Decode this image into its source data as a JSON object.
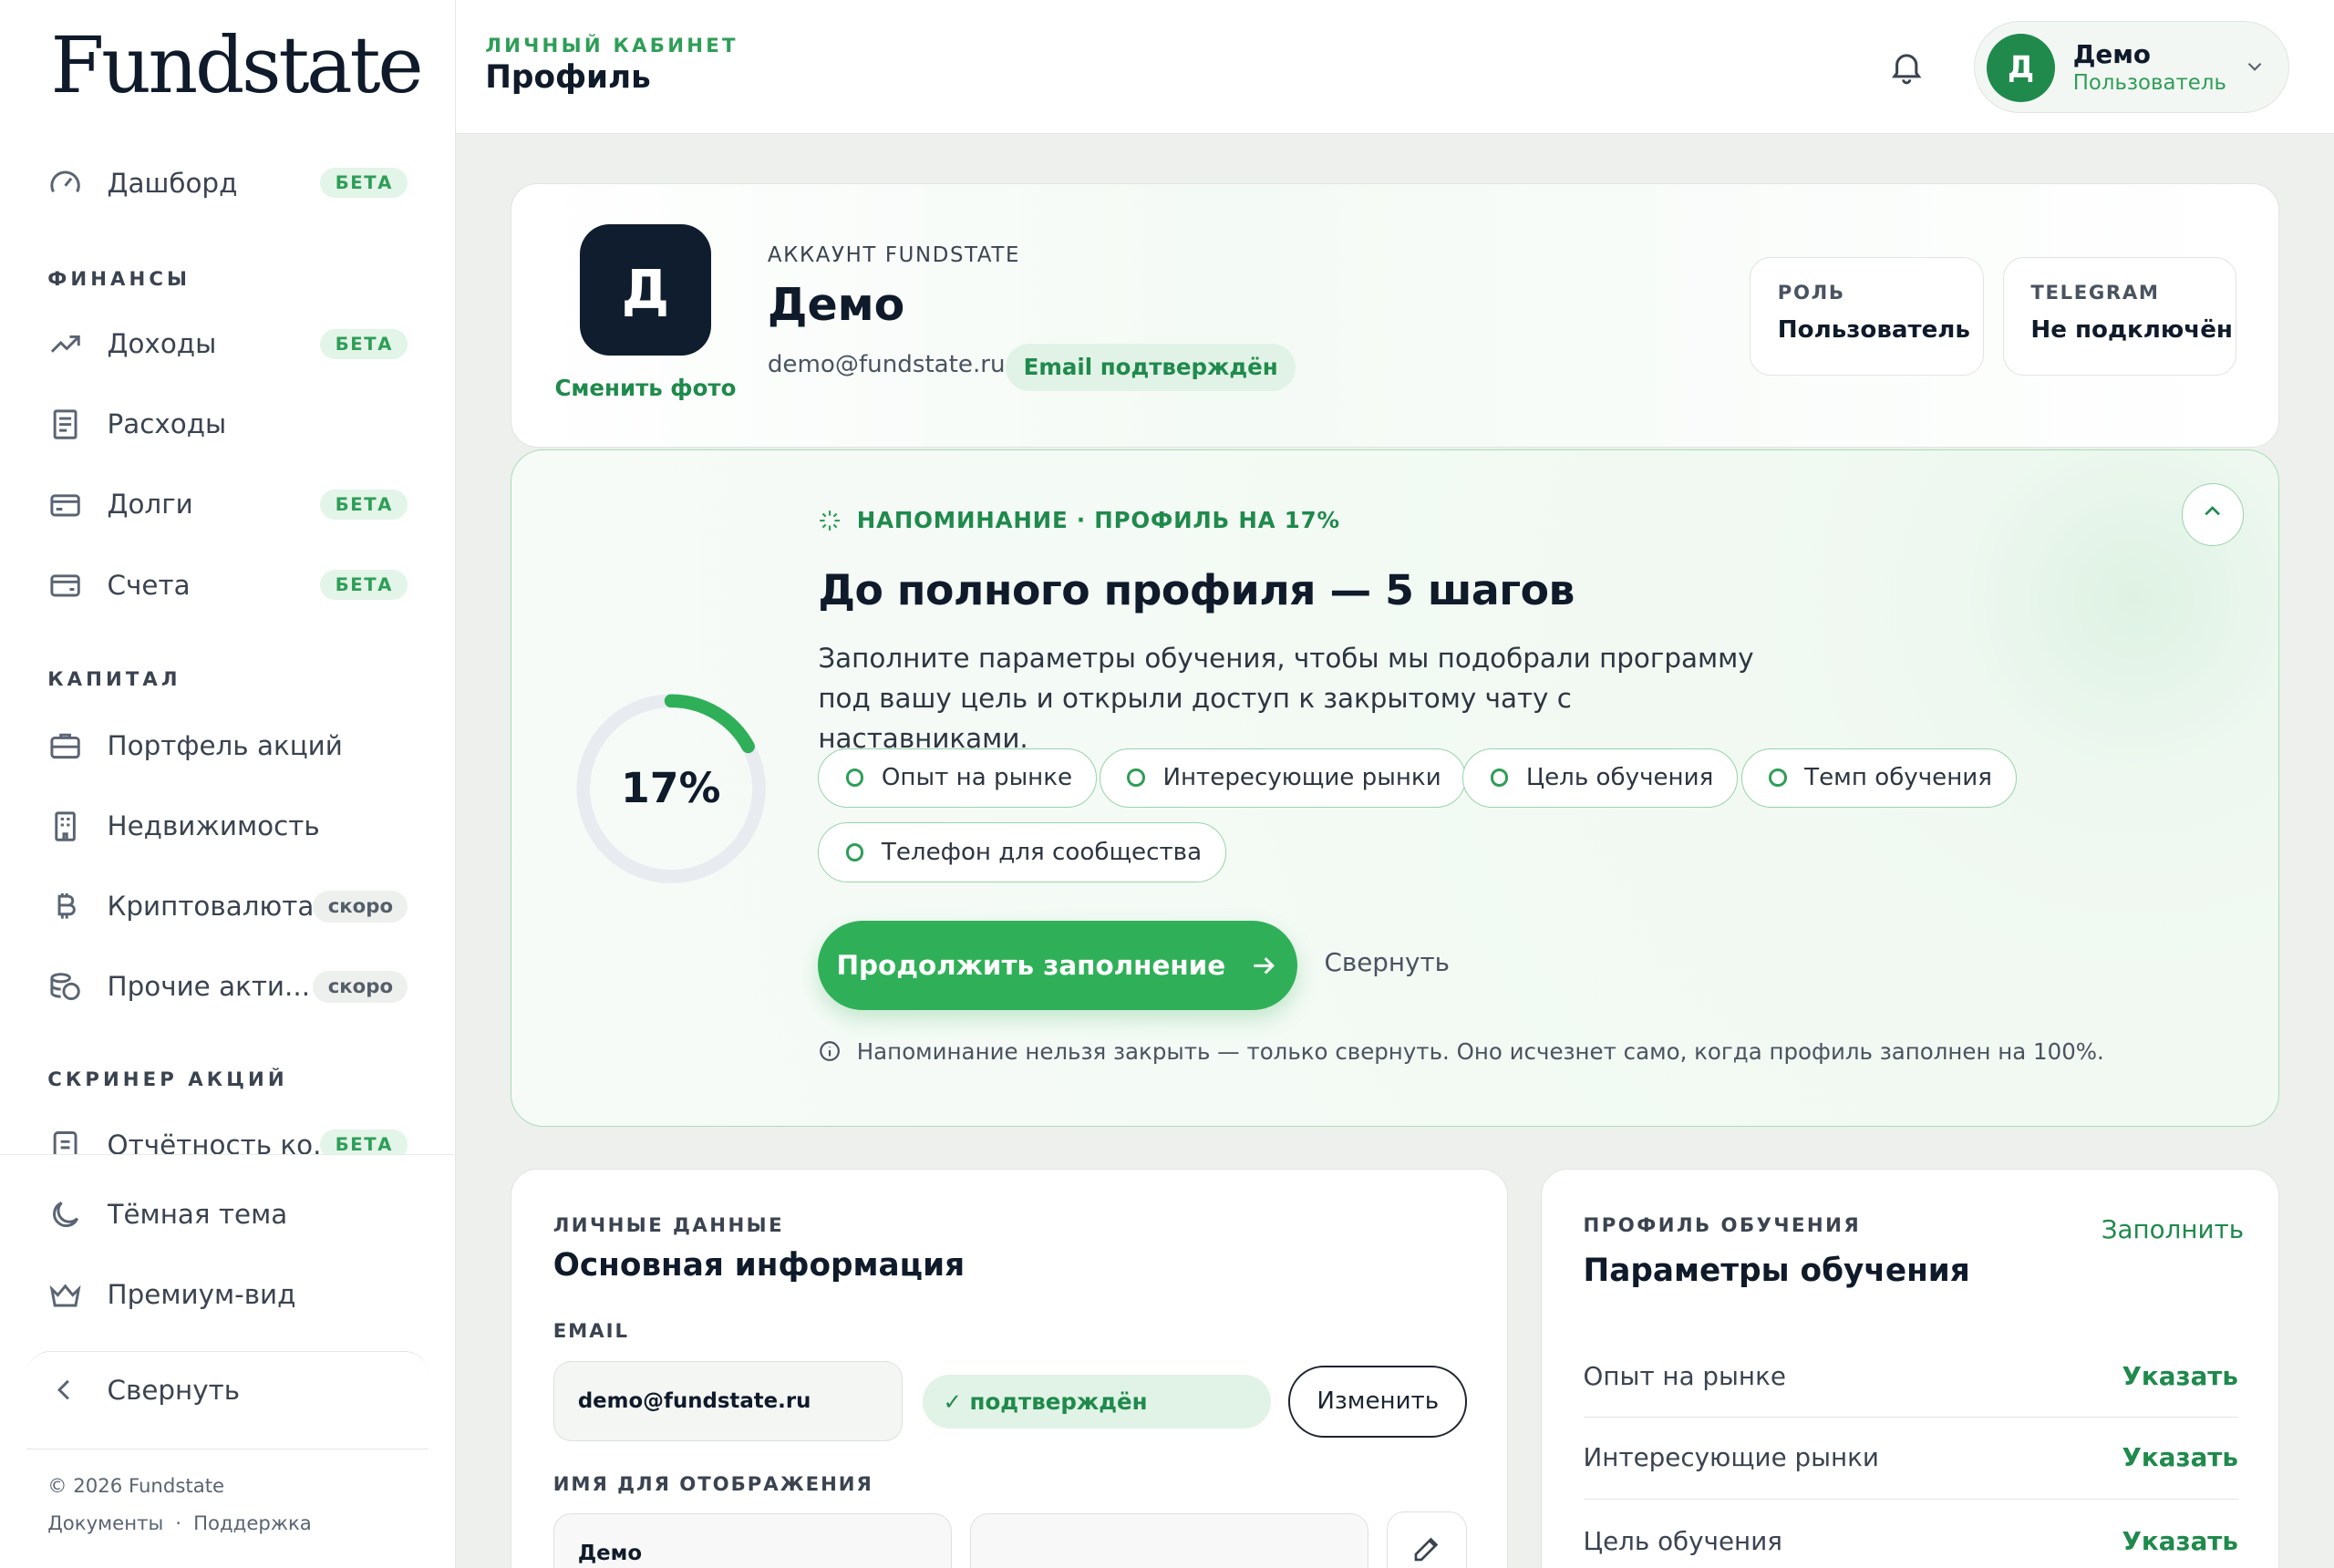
{
  "app": {
    "logo": "Fundstate"
  },
  "sidebar": {
    "dashboard": {
      "label": "Дашборд",
      "badge": "БЕТА"
    },
    "sections": {
      "finance": "ФИНАНСЫ",
      "capital": "КАПИТАЛ",
      "screener": "СКРИНЕР АКЦИЙ"
    },
    "items": {
      "income": {
        "label": "Доходы",
        "badge": "БЕТА"
      },
      "expenses": {
        "label": "Расходы"
      },
      "debts": {
        "label": "Долги",
        "badge": "БЕТА"
      },
      "accounts": {
        "label": "Счета",
        "badge": "БЕТА"
      },
      "stocks": {
        "label": "Портфель акций"
      },
      "realty": {
        "label": "Недвижимость"
      },
      "crypto": {
        "label": "Криптовалюта",
        "badge": "скоро"
      },
      "other": {
        "label": "Прочие акти...",
        "badge": "скоро"
      },
      "reports": {
        "label": "Отчётность ко...",
        "badge": "БЕТА"
      }
    },
    "bottom": {
      "dark_theme": "Тёмная тема",
      "premium": "Премиум-вид",
      "collapse": "Свернуть"
    },
    "footer": {
      "copyright": "© 2026 Fundstate",
      "docs": "Документы",
      "dot": "·",
      "support": "Поддержка"
    }
  },
  "topbar": {
    "kicker": "ЛИЧНЫЙ КАБИНЕТ",
    "title": "Профиль",
    "user": {
      "initial": "Д",
      "name": "Демо",
      "role": "Пользователь"
    }
  },
  "account": {
    "initial": "Д",
    "change_photo": "Сменить фото",
    "kicker": "АККАУНТ FUNDSTATE",
    "name": "Демо",
    "email": "demo@fundstate.ru",
    "verified": "Email подтверждён",
    "role_label": "РОЛЬ",
    "role_value": "Пользователь",
    "telegram_label": "TELEGRAM",
    "telegram_value": "Не подключён"
  },
  "reminder": {
    "progress_label": "17%",
    "progress": 0.17,
    "kicker": "НАПОМИНАНИЕ · ПРОФИЛЬ НА 17%",
    "title": "До полного профиля — 5 шагов",
    "description": "Заполните параметры обучения, чтобы мы подобрали программу под вашу цель и открыли доступ к закрытому чату с наставниками.",
    "chips": [
      "Опыт на рынке",
      "Интересующие рынки",
      "Цель обучения",
      "Темп обучения",
      "Телефон для сообщества"
    ],
    "cta": "Продолжить заполнение",
    "collapse": "Свернуть",
    "note": "Напоминание нельзя закрыть — только свернуть. Оно исчезнет само, когда профиль заполнен на 100%."
  },
  "personal": {
    "kicker": "ЛИЧНЫЕ ДАННЫЕ",
    "title": "Основная информация",
    "email_label": "EMAIL",
    "email_value": "demo@fundstate.ru",
    "email_status": "✓ подтверждён",
    "change_button": "Изменить",
    "display_name_label": "ИМЯ ДЛЯ ОТОБРАЖЕНИЯ",
    "first_name": "Демо",
    "last_name": ""
  },
  "learning": {
    "kicker": "ПРОФИЛЬ ОБУЧЕНИЯ",
    "fill": "Заполнить",
    "title": "Параметры обучения",
    "rows": [
      {
        "label": "Опыт на рынке",
        "action": "Указать"
      },
      {
        "label": "Интересующие рынки",
        "action": "Указать"
      },
      {
        "label": "Цель обучения",
        "action": "Указать"
      }
    ]
  },
  "colors": {
    "accent": "#2fb058",
    "accent_dark": "#1f8a4c",
    "navy": "#101d2e",
    "badge_bg": "#e3f4e8"
  }
}
